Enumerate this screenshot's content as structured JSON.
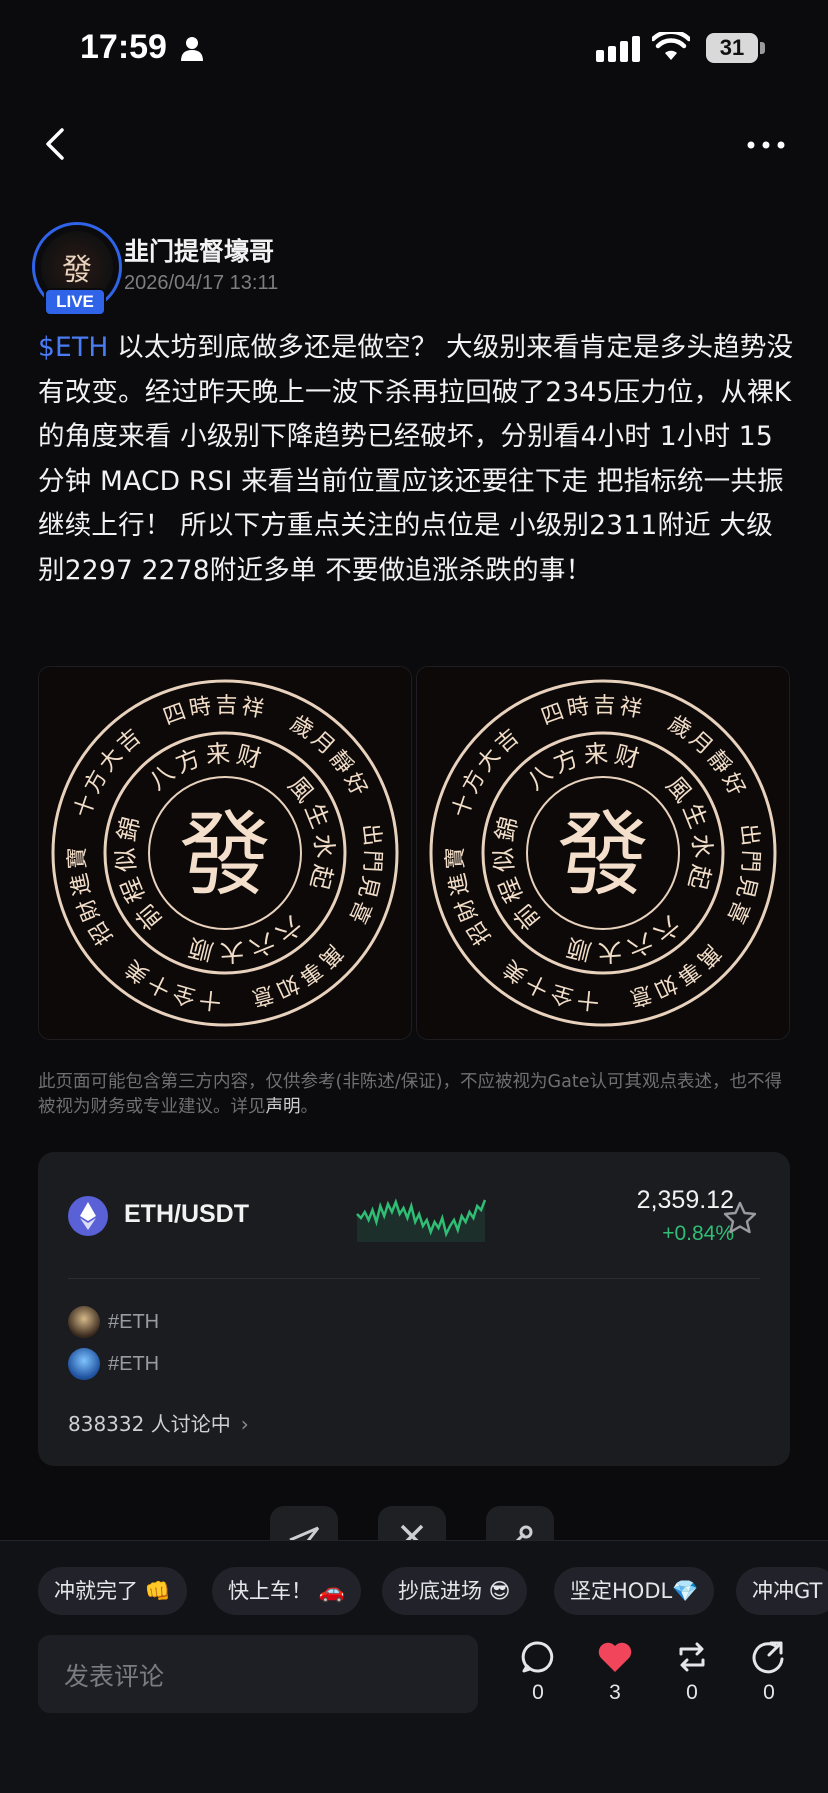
{
  "status_bar": {
    "time": "17:59",
    "battery": "31"
  },
  "author": {
    "name": "韭门提督壕哥",
    "post_time": "2026/04/17 13:11",
    "live_badge": "LIVE",
    "avatar_char": "發"
  },
  "post": {
    "tag": "$ETH",
    "body": " 以太坊到底做多还是做空？ 大级别来看肯定是多头趋势没有改变。经过昨天晚上一波下杀再拉回破了2345压力位，从裸K的角度来看 小级别下降趋势已经破坏，分别看4小时 1小时 15分钟 MACD RSI 来看当前位置应该还要往下走 把指标统一共振继续上行！ 所以下方重点关注的点位是 小级别2311附近 大级别2297 2278附近多单  不要做追涨杀跌的事！"
  },
  "images": [
    {
      "center": "發",
      "inner": [
        "八方来财",
        "風生水起",
        "六六大顺",
        "前程似錦"
      ],
      "outer": [
        "四時吉祥",
        "歲月靜好",
        "出門見喜",
        "萬事如意",
        "十全十美",
        "招財進寶",
        "十方大吉"
      ]
    },
    {
      "center": "發",
      "inner": [
        "八方来财",
        "風生水起",
        "六六大顺",
        "前程似錦"
      ],
      "outer": [
        "四時吉祥",
        "歲月靜好",
        "出門見喜",
        "萬事如意",
        "十全十美",
        "招財進寶",
        "十方大吉"
      ]
    }
  ],
  "disclaimer": {
    "text": "此页面可能包含第三方内容，仅供参考(非陈述/保证)，不应被视为Gate认可其观点表述，也不得被视为财务或专业建议。详见",
    "link": "声明",
    "end": "。"
  },
  "market_card": {
    "pair": "ETH/USDT",
    "price": "2,359.12",
    "change": "+0.84%",
    "colors": {
      "up": "#2fbe74",
      "eth": "#5a60d6"
    },
    "topics": [
      {
        "label": "#ETH"
      },
      {
        "label": "#ETH"
      }
    ],
    "discussion": "838332 人讨论中",
    "sparkline": [
      22,
      26,
      20,
      28,
      18,
      30,
      14,
      24,
      12,
      20,
      10,
      22,
      16,
      26,
      14,
      30,
      22,
      34,
      28,
      40,
      30,
      36,
      26,
      42,
      34,
      28,
      38,
      24,
      30,
      20,
      26,
      14,
      18,
      8
    ]
  },
  "quick_replies": [
    "冲就完了 👊",
    "快上车！ 🚗",
    "抄底进场 😎",
    "坚定HODL💎",
    "冲冲GT"
  ],
  "comment": {
    "placeholder": "发表评论"
  },
  "actions": {
    "comments": "0",
    "likes": "3",
    "reposts": "0",
    "shares": "0"
  }
}
